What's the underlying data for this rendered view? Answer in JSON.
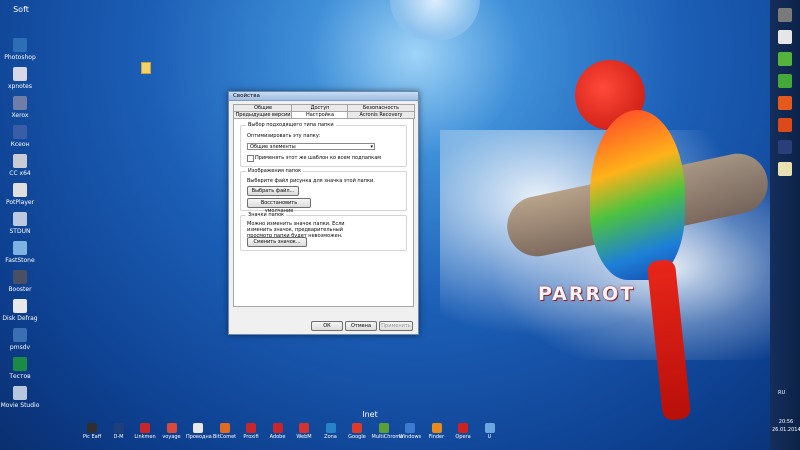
{
  "desktop": {
    "group_soft": "Soft",
    "group_inet": "Inet",
    "icons": [
      {
        "label": "Photoshop",
        "color": "#2c6fb5"
      },
      {
        "label": "xpnotes",
        "color": "#d8d8e8"
      },
      {
        "label": "Xerox",
        "color": "#6f7ea8"
      },
      {
        "label": "Ксеон",
        "color": "#3a5ea5"
      },
      {
        "label": "CC x64",
        "color": "#c9ccd6"
      },
      {
        "label": "PotPlayer",
        "color": "#e0e0e0"
      },
      {
        "label": "STDUN",
        "color": "#bcc9e0"
      },
      {
        "label": "FastStone",
        "color": "#7eb3e2"
      },
      {
        "label": "Booster",
        "color": "#4a4f63"
      },
      {
        "label": "Disk Defrag",
        "color": "#e8e8e8"
      },
      {
        "label": "pmsdv",
        "color": "#3b6fb3"
      },
      {
        "label": "Тестов",
        "color": "#1a8a45"
      },
      {
        "label": "Movie Studio",
        "color": "#b8c7de"
      }
    ],
    "parrot_label": "PARROT"
  },
  "dialog": {
    "title": "Свойства",
    "tabs_row1": [
      "Общие",
      "Доступ",
      "Безопасность"
    ],
    "tabs_row2": [
      "Предыдущие версии",
      "Настройка",
      "Acronis Recovery"
    ],
    "active_tab": "Настройка",
    "group1": {
      "title": "Выбор подходящего типа папки",
      "optimize_label": "Оптимизировать эту папку:",
      "select_value": "Общие элементы",
      "checkbox_label": "Применять этот же шаблон ко всем подпапкам"
    },
    "group2": {
      "title": "Изображения папок",
      "text": "Выберите файл рисунка для значка этой папки.",
      "choose_button": "Выбрать файл...",
      "restore_button": "Восстановить умолчание"
    },
    "group3": {
      "title": "Значки папок",
      "text": "Можно изменить значок папки. Если изменить значок, предварительный просмотр папки будет невозможен.",
      "change_button": "Сменить значок..."
    },
    "buttons": {
      "ok": "ОК",
      "cancel": "Отмена",
      "apply": "Применить"
    }
  },
  "taskbar": {
    "items": [
      {
        "label": "Pic Eaff",
        "color": "#2f2f2f"
      },
      {
        "label": "D-M",
        "color": "#1f3f7a"
      },
      {
        "label": "Linkmen",
        "color": "#c8262a"
      },
      {
        "label": "voyage",
        "color": "#d94a3d"
      },
      {
        "label": "Проводна",
        "color": "#e8e8e8"
      },
      {
        "label": "BitComet",
        "color": "#e26a20"
      },
      {
        "label": "Proxifi",
        "color": "#c8262a"
      },
      {
        "label": "Adobe",
        "color": "#c8262a"
      },
      {
        "label": "WebM",
        "color": "#d6322f"
      },
      {
        "label": "Zona",
        "color": "#2a83c8"
      },
      {
        "label": "Google",
        "color": "#de3a2b"
      },
      {
        "label": "MultiChrome",
        "color": "#5aa035"
      },
      {
        "label": "Windows",
        "color": "#3b7bd0"
      },
      {
        "label": "Finder",
        "color": "#e58a1c"
      },
      {
        "label": "Opera",
        "color": "#d0201f"
      },
      {
        "label": "U",
        "color": "#6ba6e0"
      }
    ]
  },
  "tray": {
    "lang": "RU",
    "time": "20:56",
    "date": "26.01.2014"
  },
  "right_bar_colors": [
    "#7a7a7a",
    "#e6e6e6",
    "#55b33b",
    "#47a83a",
    "#e6591c",
    "#dc4a1a",
    "#2a3f7a",
    "#e8e0b0"
  ]
}
